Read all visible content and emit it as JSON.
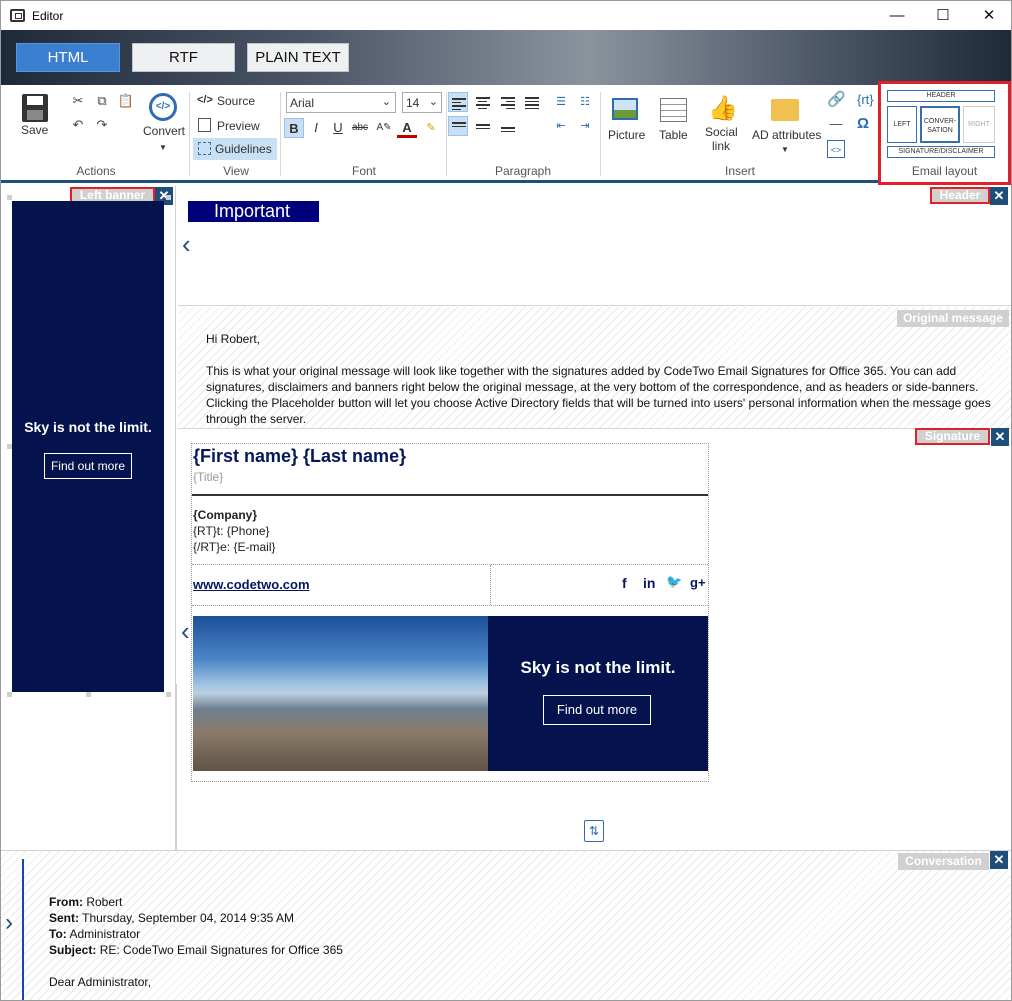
{
  "window": {
    "title": "Editor",
    "minimize": "—",
    "maximize": "☐",
    "close": "✕"
  },
  "modes": [
    "HTML",
    "RTF",
    "PLAIN TEXT"
  ],
  "ribbon": {
    "actions": {
      "save": "Save",
      "convert": "Convert",
      "label": "Actions"
    },
    "view": {
      "source": "Source",
      "preview": "Preview",
      "guidelines": "Guidelines",
      "label": "View"
    },
    "font": {
      "family": "Arial",
      "size": "14",
      "label": "Font"
    },
    "paragraph": {
      "label": "Paragraph"
    },
    "insert": {
      "picture": "Picture",
      "table": "Table",
      "social": "Social link",
      "ad": "AD attributes",
      "rt": "{rt}",
      "label": "Insert"
    },
    "email_layout": {
      "header": "HEADER",
      "left": "LEFT",
      "conversation": "CONVER-SATION",
      "right": "RIGHT",
      "signature": "SIGNATURE/DISCLAIMER",
      "label": "Email layout"
    }
  },
  "left_banner": {
    "tag": "Left banner",
    "headline": "Sky is not the limit.",
    "button": "Find out more",
    "background": "#04124e"
  },
  "header": {
    "tag": "Header",
    "important": "Important"
  },
  "original": {
    "tag": "Original message",
    "greeting": "Hi Robert,",
    "body": "This is what your original message will look like together with the signatures added by CodeTwo Email Signatures for Office 365. You can add signatures, disclaimers and banners right below the original message, at the very bottom of the correspondence, and as headers or side-banners. Clicking the Placeholder button will let you choose Active Directory fields that will be turned into users' personal information when the message goes through the server."
  },
  "signature": {
    "tag": "Signature",
    "name": "{First name} {Last name}",
    "title": "{Title}",
    "company": "{Company}",
    "phone": "{RT}t: {Phone}",
    "email": "{/RT}e: {E-mail}",
    "website": "www.codetwo.com",
    "social": [
      "f",
      "in",
      "🐦",
      "g+"
    ],
    "banner_headline": "Sky is not the limit.",
    "banner_button": "Find out more"
  },
  "conversation": {
    "tag": "Conversation",
    "from_label": "From:",
    "from": "Robert",
    "sent_label": "Sent:",
    "sent": "Thursday, September 04, 2014 9:35 AM",
    "to_label": "To:",
    "to": "Administrator",
    "subject_label": "Subject:",
    "subject": "RE: CodeTwo Email Signatures for Office 365",
    "greeting": "Dear Administrator,"
  },
  "colors": {
    "accent": "#1f4e79",
    "navy": "#04124e",
    "highlight_red": "#e0202a",
    "mode_active": "#3b7fd0"
  }
}
